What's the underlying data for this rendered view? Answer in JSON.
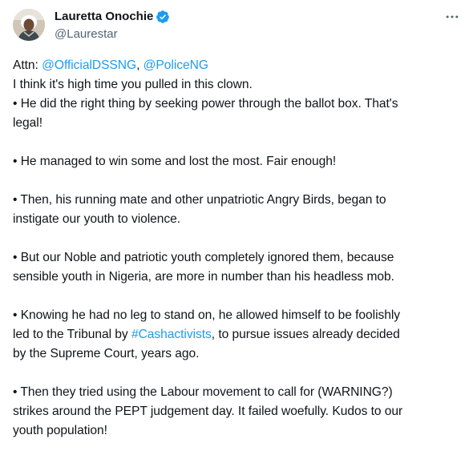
{
  "author": {
    "display_name": "Lauretta Onochie",
    "handle": "@Laurestar",
    "verified": true
  },
  "more_icon": "more-horizontal-icon",
  "colors": {
    "link": "#1d9bf0",
    "verified_badge": "#1d9bf0",
    "text": "#0f1419",
    "secondary": "#536471"
  },
  "tweet": {
    "attn_prefix": "Attn: ",
    "mention_1": "@OfficialDSSNG",
    "attn_sep": ", ",
    "mention_2": "@PoliceNG",
    "intro": "I think it's high time you pulled in this clown.",
    "p1_l1": "• He did the right thing by seeking power through the ballot box. That's",
    "p1_l2": "legal!",
    "p2_l1": "• He managed to win some and lost the most. Fair enough!",
    "p3_l1": "• Then, his running mate and other unpatriotic Angry Birds, began to",
    "p3_l2": "instigate our youth to violence.",
    "p4_l1": "• But our Noble and patriotic youth completely ignored them, because",
    "p4_l2": "sensible youth in Nigeria, are more in number than his headless mob.",
    "p5_l1": "• Knowing he had no leg to stand on, he allowed himself to be foolishly",
    "p5_l2_pre": "led to the Tribunal by ",
    "p5_hashtag": "#Cashactivists",
    "p5_l2_post": ", to pursue issues already decided",
    "p5_l3": "by the Supreme Court, years ago.",
    "p6_l1": "• Then they tried using the Labour movement to call for (WARNING?)",
    "p6_l2": "strikes around the PEPT judgement day. It failed woefully. Kudos to our",
    "p6_l3": "youth population!"
  }
}
